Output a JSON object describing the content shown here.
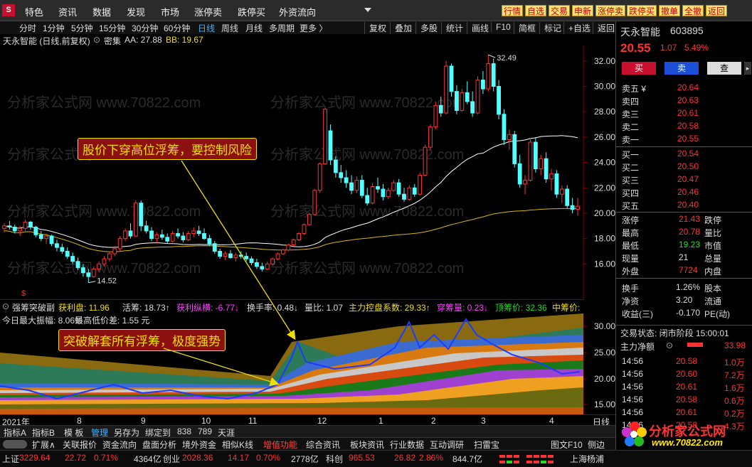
{
  "topbar": {
    "logo": "S",
    "menus": [
      "特色",
      "资讯",
      "数据",
      "发现",
      "市场",
      "涨停卖",
      "跌停买",
      "外资流向"
    ],
    "buttons": [
      "行情",
      "自选",
      "交易",
      "申新",
      "涨停卖",
      "跌停买",
      "撤单",
      "全撤",
      "返回"
    ]
  },
  "periods": [
    "分时",
    "1分钟",
    "5分钟",
    "15分钟",
    "30分钟",
    "60分钟",
    "日线",
    "周线",
    "月线",
    "多周期",
    "更多 〉"
  ],
  "period_active": "日线",
  "rightTools": [
    "复权",
    "叠加",
    "多股",
    "统计",
    "画线",
    "F10",
    "简框",
    "标记",
    "+自选",
    "返回"
  ],
  "title": {
    "name": "天永智能 (日线,前复权)",
    "mode": "密集",
    "aa": "AA: 27.88",
    "bb": "BB: 19.67"
  },
  "watermark": "分析家公式网 www.70822.com",
  "chart_data": {
    "type": "candlestick",
    "yaxis_ticks": [
      16.0,
      18.0,
      20.0,
      22.0,
      24.0,
      26.0,
      28.0,
      30.0,
      32.0
    ],
    "ylim": [
      14.0,
      33.0
    ],
    "annotations": [
      "32.49",
      "14.52"
    ],
    "dollar_marker": "$",
    "candles": [
      [
        18.8,
        19.2,
        18.5,
        19.0
      ],
      [
        19.0,
        19.4,
        18.7,
        18.9
      ],
      [
        18.9,
        19.1,
        18.4,
        18.6
      ],
      [
        18.6,
        19.0,
        18.2,
        18.8
      ],
      [
        18.8,
        19.5,
        18.6,
        19.3
      ],
      [
        19.3,
        19.4,
        18.7,
        18.9
      ],
      [
        18.9,
        19.0,
        18.1,
        18.3
      ],
      [
        18.3,
        18.6,
        17.8,
        18.0
      ],
      [
        18.0,
        18.4,
        17.6,
        18.2
      ],
      [
        18.2,
        18.3,
        17.4,
        17.6
      ],
      [
        17.6,
        17.9,
        17.0,
        17.3
      ],
      [
        17.3,
        17.6,
        16.8,
        17.0
      ],
      [
        17.0,
        17.3,
        16.4,
        16.6
      ],
      [
        16.6,
        16.9,
        16.0,
        16.2
      ],
      [
        16.2,
        16.5,
        15.5,
        15.7
      ],
      [
        15.7,
        16.0,
        15.0,
        15.3
      ],
      [
        15.3,
        15.6,
        14.52,
        15.0
      ],
      [
        15.0,
        15.8,
        14.9,
        15.6
      ],
      [
        15.6,
        16.2,
        15.4,
        16.0
      ],
      [
        16.0,
        16.6,
        15.8,
        16.4
      ],
      [
        16.4,
        17.0,
        16.2,
        16.8
      ],
      [
        16.8,
        17.4,
        16.6,
        17.2
      ],
      [
        17.2,
        18.2,
        17.0,
        18.0
      ],
      [
        18.0,
        18.8,
        17.8,
        18.6
      ],
      [
        18.6,
        19.2,
        18.0,
        18.2
      ],
      [
        18.2,
        21.0,
        18.1,
        20.8
      ],
      [
        20.8,
        21.0,
        18.6,
        19.0
      ],
      [
        19.0,
        19.4,
        18.4,
        18.6
      ],
      [
        18.6,
        18.9,
        17.8,
        18.0
      ],
      [
        18.0,
        18.5,
        17.6,
        18.3
      ],
      [
        18.3,
        18.7,
        17.9,
        18.1
      ],
      [
        18.1,
        18.4,
        17.6,
        17.8
      ],
      [
        17.8,
        18.6,
        17.7,
        18.4
      ],
      [
        18.4,
        18.8,
        18.0,
        18.2
      ],
      [
        18.2,
        18.5,
        17.7,
        17.9
      ],
      [
        17.9,
        18.6,
        17.8,
        18.4
      ],
      [
        18.4,
        18.9,
        18.1,
        18.6
      ],
      [
        18.6,
        19.0,
        18.2,
        18.4
      ],
      [
        18.4,
        18.8,
        17.9,
        18.0
      ],
      [
        18.0,
        18.3,
        17.4,
        17.6
      ],
      [
        17.6,
        17.8,
        16.8,
        17.0
      ],
      [
        17.0,
        17.2,
        16.4,
        16.6
      ],
      [
        16.6,
        17.0,
        16.3,
        16.8
      ],
      [
        16.8,
        17.1,
        16.4,
        16.5
      ],
      [
        16.5,
        16.9,
        16.2,
        16.7
      ],
      [
        16.7,
        17.0,
        16.4,
        16.6
      ],
      [
        16.6,
        16.9,
        16.2,
        16.4
      ],
      [
        16.4,
        16.6,
        15.9,
        16.1
      ],
      [
        16.1,
        16.4,
        15.6,
        15.8
      ],
      [
        15.8,
        16.1,
        15.4,
        15.6
      ],
      [
        15.6,
        16.2,
        15.5,
        16.0
      ],
      [
        16.0,
        16.5,
        15.9,
        16.4
      ],
      [
        16.4,
        16.9,
        16.3,
        16.8
      ],
      [
        16.8,
        17.2,
        16.7,
        17.1
      ],
      [
        17.1,
        17.6,
        17.0,
        17.5
      ],
      [
        17.5,
        18.0,
        17.4,
        17.9
      ],
      [
        17.9,
        18.5,
        17.8,
        18.4
      ],
      [
        18.4,
        19.2,
        18.3,
        19.1
      ],
      [
        19.1,
        20.0,
        19.0,
        19.9
      ],
      [
        19.9,
        21.9,
        19.8,
        21.8
      ],
      [
        21.8,
        24.0,
        21.6,
        23.9
      ],
      [
        23.9,
        28.3,
        23.8,
        28.2
      ],
      [
        26.5,
        27.0,
        23.8,
        24.2
      ],
      [
        24.2,
        24.5,
        22.8,
        23.2
      ],
      [
        23.2,
        23.8,
        22.4,
        22.8
      ],
      [
        22.8,
        23.4,
        22.0,
        22.4
      ],
      [
        22.4,
        23.0,
        21.5,
        21.8
      ],
      [
        21.8,
        22.9,
        21.6,
        22.6
      ],
      [
        22.6,
        23.0,
        21.2,
        21.4
      ],
      [
        21.4,
        22.0,
        20.6,
        20.8
      ],
      [
        20.8,
        22.4,
        20.7,
        22.1
      ],
      [
        22.1,
        22.8,
        21.6,
        21.9
      ],
      [
        21.9,
        22.3,
        21.0,
        21.3
      ],
      [
        21.3,
        22.0,
        21.1,
        21.8
      ],
      [
        21.8,
        22.6,
        21.7,
        22.4
      ],
      [
        22.4,
        22.7,
        21.3,
        21.5
      ],
      [
        21.5,
        22.0,
        20.9,
        21.1
      ],
      [
        21.1,
        22.2,
        21.0,
        22.0
      ],
      [
        22.0,
        22.3,
        21.3,
        21.5
      ],
      [
        21.5,
        23.2,
        21.4,
        23.0
      ],
      [
        23.0,
        25.4,
        22.9,
        25.2
      ],
      [
        25.2,
        27.0,
        25.0,
        26.8
      ],
      [
        26.8,
        28.8,
        26.6,
        28.5
      ],
      [
        28.5,
        29.2,
        27.6,
        27.9
      ],
      [
        27.9,
        32.0,
        27.8,
        31.6
      ],
      [
        31.6,
        31.8,
        29.2,
        29.6
      ],
      [
        29.6,
        30.1,
        27.8,
        28.1
      ],
      [
        28.1,
        29.8,
        28.0,
        29.5
      ],
      [
        29.5,
        30.4,
        28.6,
        28.8
      ],
      [
        28.8,
        29.6,
        27.6,
        27.9
      ],
      [
        27.9,
        30.8,
        27.8,
        30.5
      ],
      [
        30.5,
        31.2,
        29.4,
        29.8
      ],
      [
        29.8,
        32.49,
        29.6,
        31.8
      ],
      [
        31.8,
        32.2,
        29.6,
        30.0
      ],
      [
        30.0,
        30.5,
        27.4,
        27.8
      ],
      [
        27.8,
        28.2,
        25.4,
        25.8
      ],
      [
        25.8,
        26.6,
        25.0,
        26.2
      ],
      [
        26.2,
        26.5,
        23.6,
        23.9
      ],
      [
        23.9,
        24.6,
        22.0,
        22.3
      ],
      [
        22.3,
        23.0,
        21.5,
        22.6
      ],
      [
        22.6,
        25.9,
        22.5,
        25.6
      ],
      [
        25.6,
        26.0,
        23.2,
        23.5
      ],
      [
        23.5,
        24.6,
        23.0,
        24.3
      ],
      [
        24.3,
        24.8,
        22.4,
        22.7
      ],
      [
        22.7,
        23.5,
        21.8,
        23.1
      ],
      [
        23.1,
        23.4,
        21.2,
        21.5
      ],
      [
        21.5,
        22.2,
        20.8,
        21.9
      ],
      [
        21.9,
        22.2,
        20.4,
        20.6
      ],
      [
        20.6,
        21.2,
        20.0,
        20.3
      ],
      [
        20.3,
        21.2,
        19.8,
        20.55
      ]
    ]
  },
  "annotations": {
    "callout1": "股价下穿高位浮筹，要控制风险",
    "callout2": "突破解套所有浮筹，极度强势"
  },
  "indicator": {
    "name": "强筹突破副",
    "items": [
      {
        "label": "获利盘: 11.96",
        "color": "#f0e000"
      },
      {
        "label": "活筹: 18.73↑",
        "color": "#dddddd"
      },
      {
        "label": "获利纵横: -6.77↓",
        "color": "#ff44ff"
      },
      {
        "label": "换手率: 0.48↓",
        "color": "#dddddd"
      },
      {
        "label": "量比: 1.07",
        "color": "#dddddd"
      },
      {
        "label": "主力控盘系数: 29.33↑",
        "color": "#f0e000"
      },
      {
        "label": "穿筹量: 0.23↓",
        "color": "#ff44ff"
      },
      {
        "label": "顶筹价: 32.36",
        "color": "#22dd22"
      },
      {
        "label": "中筹价:",
        "color": "#f0e000"
      }
    ],
    "sub1": "今日最大振幅: 8.06%",
    "sub2": "最高低价差: 1.55 元",
    "yticks": [
      "15.00",
      "20.00",
      "25.00",
      "30.00"
    ]
  },
  "dateaxis": {
    "labels": [
      "2021年",
      "8",
      "9",
      "10",
      "11",
      "12",
      "1",
      "2",
      "3",
      "4"
    ],
    "right": "日线"
  },
  "tabs": [
    "指标A",
    "指标B",
    "模 板",
    "管理",
    "另存为",
    "绑定到",
    "838",
    "789",
    "天涯"
  ],
  "functions": [
    "扩展∧",
    "关联报价",
    "资金流向",
    "盘面分析",
    "境外资金",
    "相似K线",
    "增值功能",
    "综合资讯",
    "板块资讯",
    "行业数据",
    "互动调研",
    "扫雷宝",
    "图文F10",
    "侧边"
  ],
  "market": [
    {
      "t": "上证",
      "c": "white"
    },
    {
      "t": "3229.64",
      "c": "red"
    },
    {
      "t": "22.72",
      "c": "red"
    },
    {
      "t": "0.71%",
      "c": "red"
    },
    {
      "t": "4364亿",
      "c": "white"
    },
    {
      "t": "创业",
      "c": "white"
    },
    {
      "t": "2028.36",
      "c": "red"
    },
    {
      "t": "14.17",
      "c": "red"
    },
    {
      "t": "0.70%",
      "c": "red"
    },
    {
      "t": "2778亿",
      "c": "white"
    },
    {
      "t": "科创",
      "c": "white"
    },
    {
      "t": "965.53",
      "c": "red"
    },
    {
      "t": "26.82",
      "c": "red"
    },
    {
      "t": "2.86%",
      "c": "red"
    },
    {
      "t": "844.7亿",
      "c": "white"
    },
    {
      "t": "上海杨浦",
      "c": "white"
    }
  ],
  "quote": {
    "name": "天永智能",
    "code": "603895",
    "price": "20.55",
    "change": "1.07",
    "pct": "5.49%",
    "buy": "买",
    "sell": "卖",
    "query": "查",
    "asks": [
      {
        "l": "卖五 ¥",
        "p": "20.64"
      },
      {
        "l": "卖四",
        "p": "20.63"
      },
      {
        "l": "卖三",
        "p": "20.61"
      },
      {
        "l": "卖二",
        "p": "20.58"
      },
      {
        "l": "卖一",
        "p": "20.55"
      }
    ],
    "bids": [
      {
        "l": "买一",
        "p": "20.54"
      },
      {
        "l": "买二",
        "p": "20.50"
      },
      {
        "l": "买三",
        "p": "20.47"
      },
      {
        "l": "买四",
        "p": "20.46"
      },
      {
        "l": "买五",
        "p": "20.40"
      }
    ],
    "stats": [
      {
        "a": "涨停",
        "av": "21.43",
        "ac": "red",
        "b": "跌停"
      },
      {
        "a": "最高",
        "av": "20.78",
        "ac": "red",
        "b": "量比"
      },
      {
        "a": "最低",
        "av": "19.23",
        "ac": "green",
        "b": "市值"
      },
      {
        "a": "现量",
        "av": "21",
        "ac": "white",
        "b": "总量"
      },
      {
        "a": "外盘",
        "av": "7724",
        "ac": "red",
        "b": "内盘"
      }
    ],
    "stats2": [
      {
        "a": "换手",
        "av": "1.26%",
        "b": "股本"
      },
      {
        "a": "净资",
        "av": "3.20",
        "b": "流通"
      },
      {
        "a": "收益(三)",
        "av": "-0.170",
        "b": "PE(动)"
      }
    ],
    "status": "交易状态: 闭市阶段 15:00:01",
    "flow_label": "主力净额",
    "flow_value": "33.98",
    "ticks": [
      {
        "t": "14:56",
        "p": "20.58",
        "v": "1.0万"
      },
      {
        "t": "14:56",
        "p": "20.60",
        "v": "7.2万"
      },
      {
        "t": "14:56",
        "p": "20.61",
        "v": "1.6万"
      },
      {
        "t": "14:56",
        "p": "20.58",
        "v": "0.6万"
      },
      {
        "t": "14:56",
        "p": "20.61",
        "v": "0.2万"
      },
      {
        "t": "14:56",
        "p": "20.58",
        "v": "4.3万"
      }
    ]
  },
  "logo_text": "分析家公式网",
  "logo_url": "www.70822.com"
}
